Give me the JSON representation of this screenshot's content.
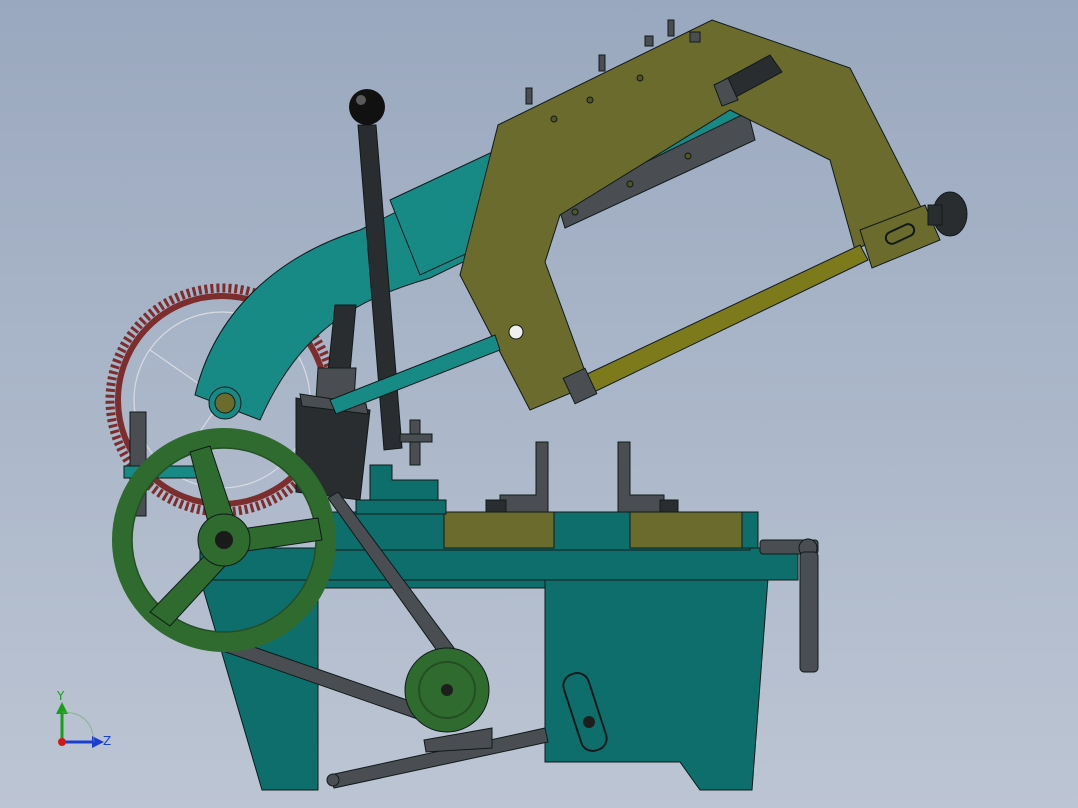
{
  "viewport": {
    "colors": {
      "base": "#0e6e6c",
      "base_dark": "#0a5553",
      "arm": "#178a86",
      "frame": "#6b6b2e",
      "frame_dark": "#545422",
      "handwheel": "#2f6a2f",
      "handwheel_dark": "#234f23",
      "gear": "#7c2d2d",
      "steel_dark": "#2a2d30",
      "steel_mid": "#4a4e52",
      "blade": "#7d7a1c",
      "outline": "#101a1a"
    }
  },
  "triad": {
    "y_label": "Y",
    "z_label": "Z",
    "x_color": "#d01818",
    "y_color": "#18a018",
    "z_color": "#1a3fd0"
  }
}
